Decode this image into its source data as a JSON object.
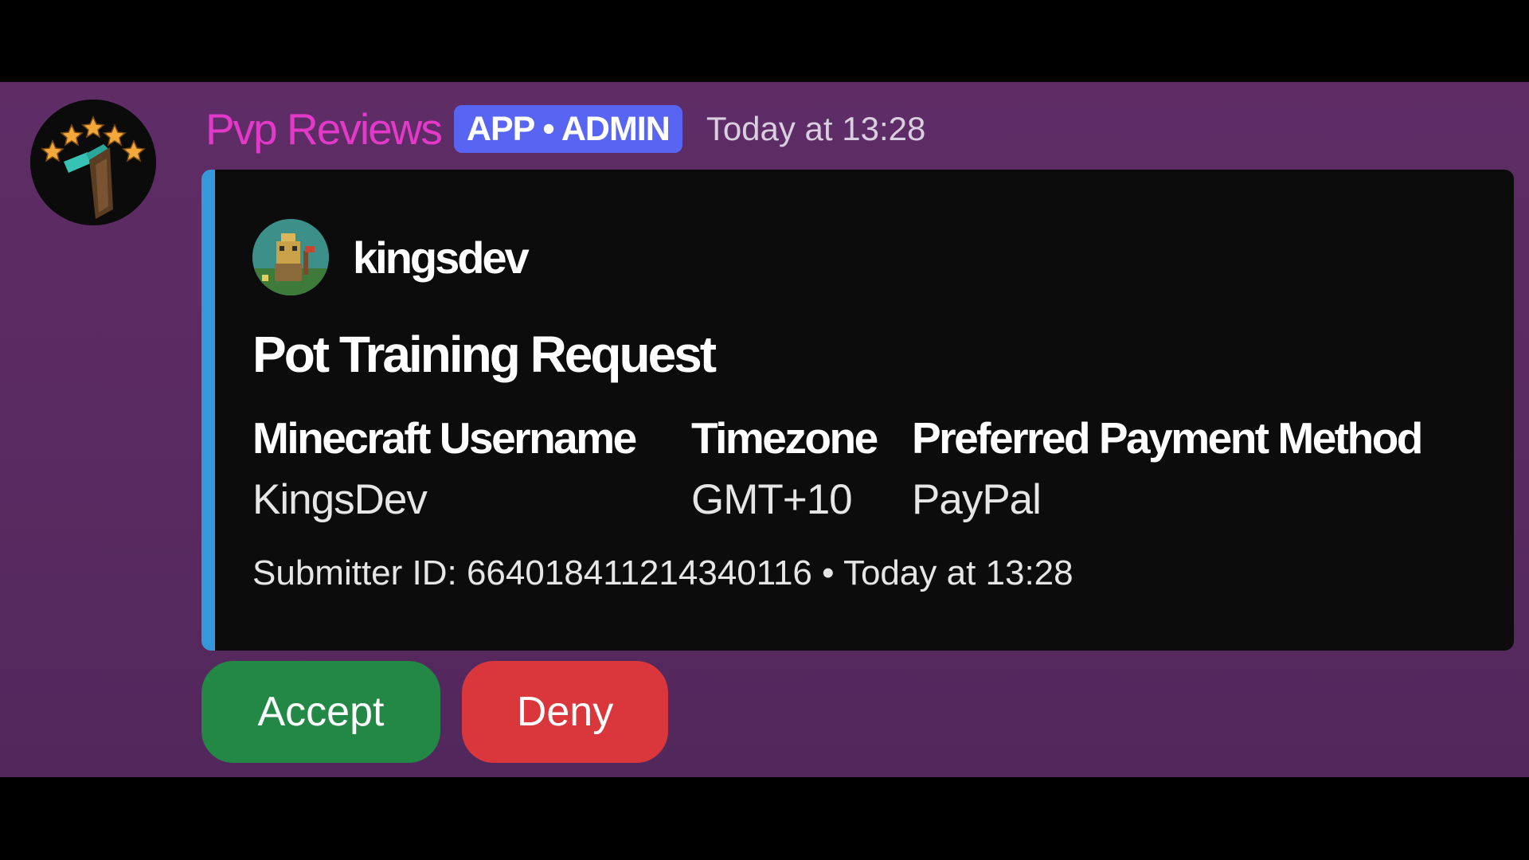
{
  "message": {
    "bot_name": "Pvp Reviews",
    "badge": "APP • ADMIN",
    "timestamp": "Today at 13:28",
    "colors": {
      "bot_name": "#e339c8",
      "badge": "#5865f2",
      "embed_accent": "#3498db"
    }
  },
  "embed": {
    "author": "kingsdev",
    "title": "Pot Training Request",
    "fields": [
      {
        "name": "Minecraft Username",
        "value": "KingsDev"
      },
      {
        "name": "Timezone",
        "value": "GMT+10"
      },
      {
        "name": "Preferred Payment Method",
        "value": "PayPal"
      }
    ],
    "footer": "Submitter ID: 664018411214340116 • Today at 13:28"
  },
  "buttons": {
    "accept": {
      "label": "Accept",
      "color": "#238845"
    },
    "deny": {
      "label": "Deny",
      "color": "#da373c"
    }
  },
  "icons": {
    "bot_avatar": "stars-sword-logo-icon",
    "author_avatar": "pixel-character-avatar-icon"
  }
}
